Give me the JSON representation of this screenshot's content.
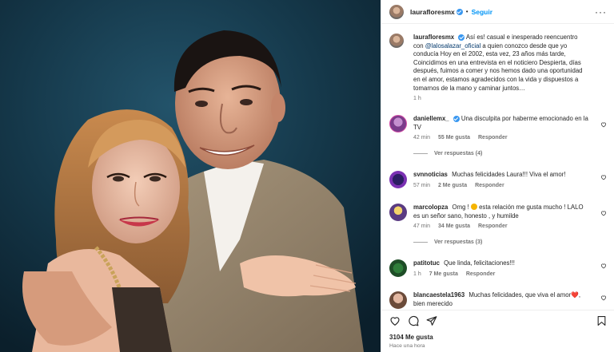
{
  "post": {
    "username": "laurafloresmx",
    "follow_label": "Seguir",
    "dot": "•",
    "more": "···",
    "caption_author": "laurafloresmx",
    "caption_pre": "Así es! casual e inesperado reencuentro con",
    "caption_mention": "@lalosalazar_oficial",
    "caption_post": "a quien conozco desde que yo conducía Hoy en el 2002, esta vez, 23 años más tarde, Coincidimos en una entrevista en el noticiero Despierta, días después, fuimos a comer y nos hemos dado una oportunidad en el amor, estamos agradecidos con la vida y dispuestos a tomarnos de la mano y caminar juntos…",
    "caption_time": "1 h",
    "likes": "3104 Me gusta",
    "posted_ago": "Hace una hora"
  },
  "comments": [
    {
      "user": "daniellemx_",
      "verified": true,
      "text": "Una disculpita por haberme emocionado en la TV",
      "time": "42 min",
      "likes": "55 Me gusta",
      "reply": "Responder",
      "replies": "Ver respuestas (4)"
    },
    {
      "user": "svnnoticias",
      "verified": false,
      "text": "Muchas felicidades Laura!!! Viva el amor!",
      "time": "57 min",
      "likes": "2 Me gusta",
      "reply": "Responder"
    },
    {
      "user": "marcolopza",
      "verified": false,
      "text_pre": "Omg ! ",
      "text_mid": " esta relación me gusta mucho ! LALO es un señor sano, honesto , y humilde",
      "time": "47 min",
      "likes": "34 Me gusta",
      "reply": "Responder",
      "replies": "Ver respuestas (3)"
    },
    {
      "user": "patitotuc",
      "verified": false,
      "text": "Que linda, felicitaciones!!!",
      "time": "1 h",
      "likes": "7 Me gusta",
      "reply": "Responder"
    },
    {
      "user": "blancaestela1963",
      "verified": false,
      "text_pre": "Muchas felicidades, que viva el amor",
      "text_heart": "❤️",
      "text_post": ", bien merecido",
      "time": "",
      "likes": "",
      "reply": ""
    }
  ],
  "icons": [
    "heart-icon",
    "comment-icon",
    "share-icon",
    "bookmark-icon",
    "more-icon",
    "verified-icon"
  ],
  "colors": {
    "link": "#0095f6",
    "verified": "#3897f0",
    "mention": "#00376b",
    "meta": "#737373"
  }
}
